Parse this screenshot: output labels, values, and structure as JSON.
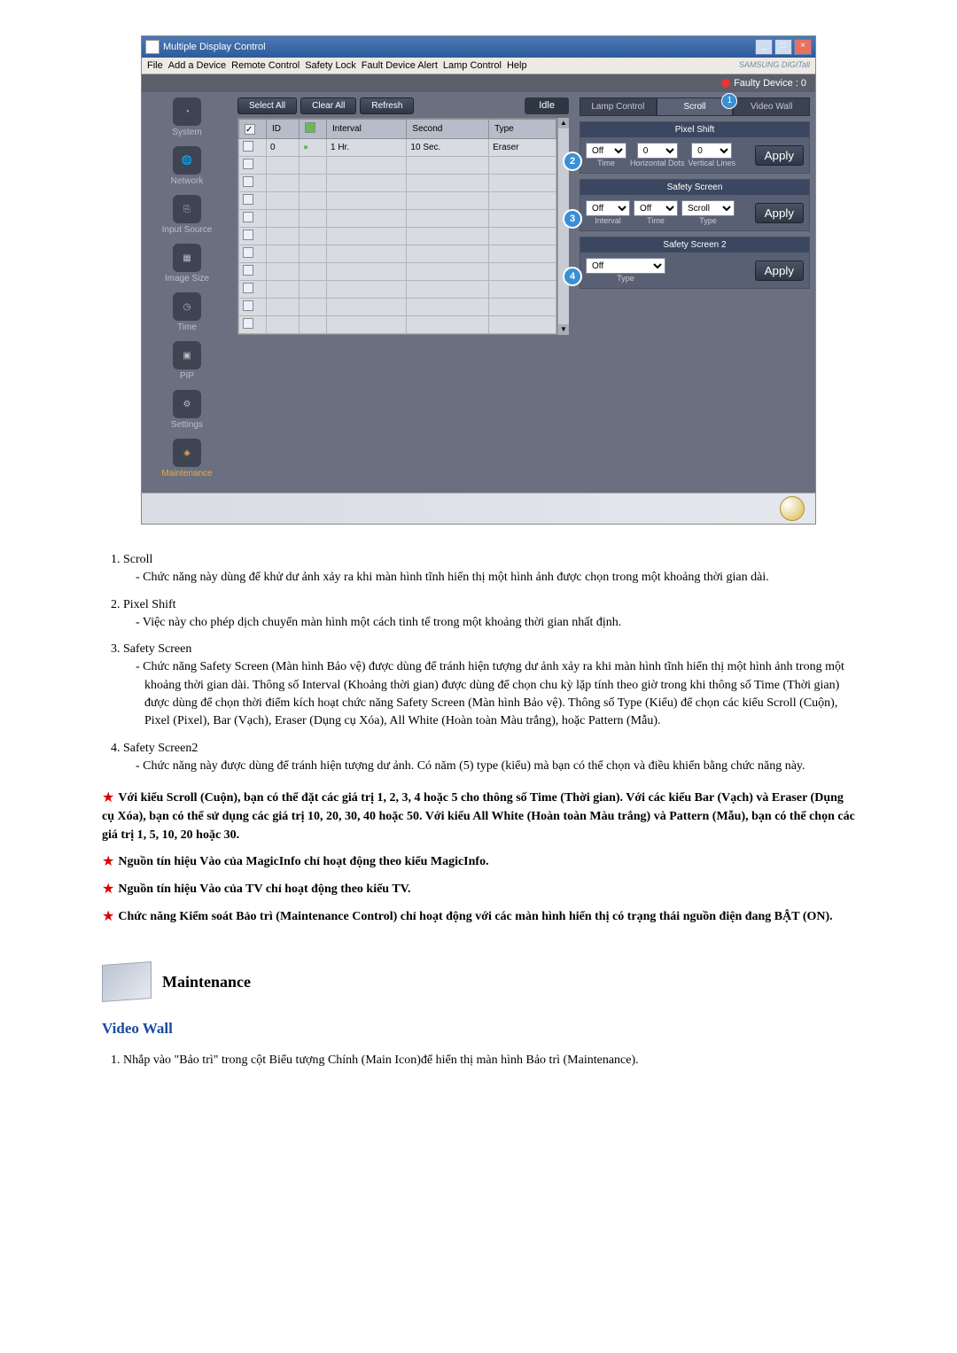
{
  "window": {
    "title": "Multiple Display Control",
    "menu": [
      "File",
      "Add a Device",
      "Remote Control",
      "Safety Lock",
      "Fault Device Alert",
      "Lamp Control",
      "Help"
    ],
    "brand": "SAMSUNG DIGITall",
    "faulty": "Faulty Device : 0"
  },
  "toolbar": {
    "select_all": "Select All",
    "clear_all": "Clear All",
    "refresh": "Refresh",
    "idle": "Idle"
  },
  "sidebar": [
    "System",
    "Network",
    "Input Source",
    "Image Size",
    "Time",
    "PIP",
    "Settings",
    "Maintenance"
  ],
  "table": {
    "headers": {
      "id": "ID",
      "interval": "Interval",
      "second": "Second",
      "type": "Type"
    },
    "row": {
      "id": "0",
      "interval": "1 Hr.",
      "second": "10 Sec.",
      "type": "Eraser"
    }
  },
  "tabs": {
    "lamp": "Lamp Control",
    "scroll": "Scroll",
    "videowall": "Video Wall",
    "badge1": "1"
  },
  "pixel_shift": {
    "title": "Pixel Shift",
    "off": "Off",
    "v1": "0",
    "v2": "0",
    "l_time": "Time",
    "l_hd": "Horizontal Dots",
    "l_vl": "Vertical Lines",
    "apply": "Apply",
    "marker": "2"
  },
  "safety_screen": {
    "title": "Safety Screen",
    "off": "Off",
    "off2": "Off",
    "scroll": "Scroll",
    "l_interval": "Interval",
    "l_time": "Time",
    "l_type": "Type",
    "apply": "Apply",
    "marker": "3"
  },
  "safety_screen2": {
    "title": "Safety Screen 2",
    "off": "Off",
    "l_type": "Type",
    "apply": "Apply",
    "marker": "4"
  },
  "doc": {
    "items": [
      {
        "h": "Scroll",
        "p": "Chức năng này dùng để khử dư ảnh xảy ra khi màn hình tĩnh hiển thị một hình ảnh được chọn trong một khoảng thời gian dài."
      },
      {
        "h": "Pixel Shift",
        "p": "Việc này cho phép dịch chuyển màn hình một cách tinh tế trong một khoảng thời gian nhất định."
      },
      {
        "h": "Safety Screen",
        "p": "Chức năng Safety Screen (Màn hình Bảo vệ) được dùng để tránh hiện tượng dư ảnh xảy ra khi màn hình tĩnh hiển thị một hình ảnh trong một khoảng thời gian dài. Thông số Interval (Khoảng thời gian) được dùng để chọn chu kỳ lặp tính theo giờ trong khi thông số Time (Thời gian) được dùng để chọn thời điểm kích hoạt chức năng Safety Screen (Màn hình Bảo vệ). Thông số Type (Kiểu) để chọn các kiểu Scroll (Cuộn), Pixel (Pixel), Bar (Vạch), Eraser (Dụng cụ Xóa), All White (Hoàn toàn Màu trắng), hoặc Pattern (Mẫu)."
      },
      {
        "h": "Safety Screen2",
        "p": "Chức năng này được dùng để tránh hiện tượng dư ảnh. Có năm (5) type (kiểu) mà bạn có thể chọn và điều khiển bằng chức năng này."
      }
    ],
    "notes": [
      "Với kiểu Scroll (Cuộn), bạn có thể đặt các giá trị 1, 2, 3, 4 hoặc 5 cho thông số Time (Thời gian). Với các kiểu Bar (Vạch) và Eraser (Dụng cụ Xóa), bạn có thể sử dụng các giá trị 10, 20, 30, 40 hoặc 50. Với kiểu All White (Hoàn toàn Màu trắng) và Pattern (Mẫu), bạn có thể chọn các giá trị 1, 5, 10, 20 hoặc 30.",
      "Nguồn tín hiệu Vào của MagicInfo chỉ hoạt động theo kiểu MagicInfo.",
      "Nguồn tín hiệu Vào của TV chỉ hoạt động theo kiểu TV.",
      "Chức năng Kiểm soát Bảo trì (Maintenance Control) chỉ hoạt động với các màn hình hiển thị có trạng thái nguồn điện đang BẬT (ON)."
    ],
    "maint_heading": "Maintenance",
    "section": "Video Wall",
    "ol1": "Nhắp vào \"Bảo trì\" trong cột Biểu tượng Chính (Main Icon)để hiển thị màn hình Bảo trì (Maintenance)."
  }
}
